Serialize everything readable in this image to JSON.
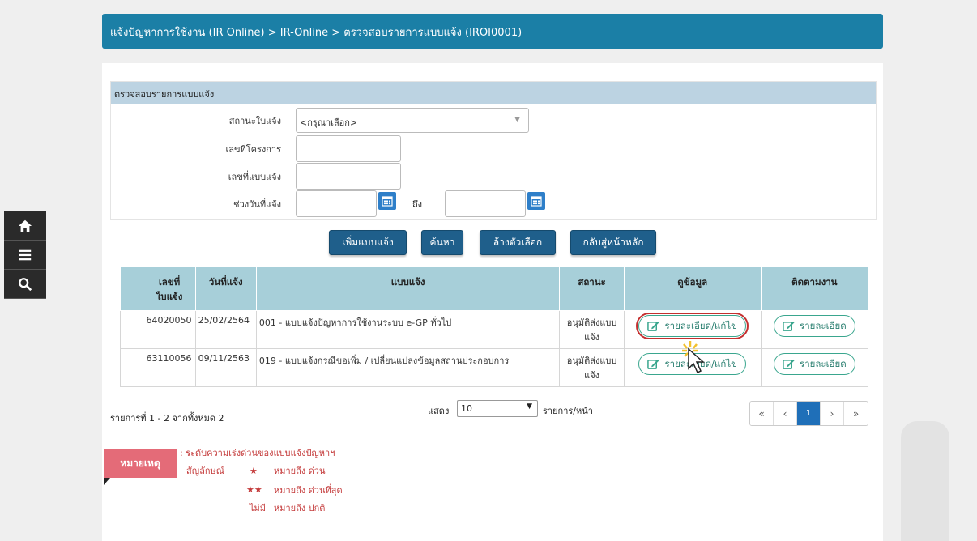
{
  "header": {
    "breadcrumb": "แจ้งปัญหาการใช้งาน (IR Online) > IR-Online > ตรวจสอบรายการแบบแจ้ง (IROI0001)"
  },
  "sidebar": {
    "home_icon": "home-icon",
    "menu_icon": "menu-icon",
    "search_icon": "search-icon"
  },
  "search": {
    "title": "ตรวจสอบรายการแบบแจ้ง",
    "status_label": "สถานะใบแจ้ง",
    "status_value": "<กรุณาเลือก>",
    "project_label": "เลขที่โครงการ",
    "form_no_label": "เลขที่แบบแจ้ง",
    "date_range_label": "ช่วงวันที่แจ้ง",
    "to_label": "ถึง"
  },
  "actions": {
    "add": "เพิ่มแบบแจ้ง",
    "search": "ค้นหา",
    "clear": "ล้างตัวเลือก",
    "back": "กลับสู่หน้าหลัก"
  },
  "table": {
    "headers": {
      "no_line1": "เลขที่",
      "no_line2": "ใบแจ้ง",
      "date": "วันที่แจ้ง",
      "form": "แบบแจ้ง",
      "status": "สถานะ",
      "view": "ดูข้อมูล",
      "follow": "ติดตามงาน"
    },
    "rows": [
      {
        "no": "64020050",
        "date": "25/02/2564",
        "form": "001 - แบบแจ้งปัญหาการใช้งานระบบ e-GP ทั่วไป",
        "status": "อนุมัติส่งแบบแจ้ง",
        "view_btn": "รายละเอียด/แก้ไข",
        "follow_btn": "รายละเอียด"
      },
      {
        "no": "63110056",
        "date": "09/11/2563",
        "form": "019 - แบบแจ้งกรณีขอเพิ่ม / เปลี่ยนแปลงข้อมูลสถานประกอบการ",
        "status": "อนุมัติส่งแบบแจ้ง",
        "view_btn": "รายละเอียด/แก้ไข",
        "follow_btn": "รายละเอียด"
      }
    ]
  },
  "footer": {
    "summary": "รายการที่ 1 - 2 จากทั้งหมด 2",
    "show_label": "แสดง",
    "page_size": "10",
    "per_page_label": "รายการ/หน้า",
    "pager": {
      "first": "«",
      "prev": "‹",
      "current": "1",
      "next": "›",
      "last": "»"
    }
  },
  "legend": {
    "tag": "หมายเหตุ",
    "intro": ": ระดับความเร่งด่วนของแบบแจ้งปัญหาฯ",
    "symbol_label": "สัญลักษณ์",
    "one_star_meaning": "หมายถึง ด่วน",
    "two_star_meaning": "หมายถึง ด่วนที่สุด",
    "none_label": "ไม่มี",
    "none_meaning": "หมายถึง ปกติ"
  },
  "colors": {
    "primary": "#1b7fa6",
    "button": "#1f5f8b",
    "table_header": "#a7cfd9",
    "legend": "#e46b78",
    "highlight": "#c42f2f"
  }
}
